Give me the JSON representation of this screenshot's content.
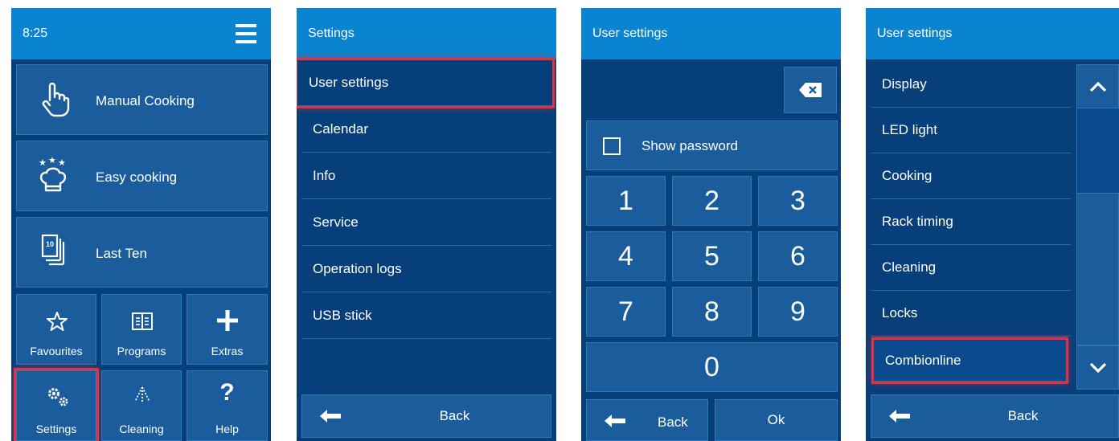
{
  "screen1": {
    "time": "8:25",
    "tiles": {
      "manual_cooking": "Manual Cooking",
      "easy_cooking": "Easy cooking",
      "last_ten": "Last Ten",
      "last_ten_badge": "10",
      "favourites": "Favourites",
      "programs": "Programs",
      "extras": "Extras",
      "settings": "Settings",
      "cleaning": "Cleaning",
      "help": "Help"
    }
  },
  "screen2": {
    "title": "Settings",
    "items": [
      "User settings",
      "Calendar",
      "Info",
      "Service",
      "Operation logs",
      "USB stick"
    ],
    "back_label": "Back"
  },
  "screen3": {
    "title": "User settings",
    "show_password_label": "Show password",
    "keys": [
      "1",
      "2",
      "3",
      "4",
      "5",
      "6",
      "7",
      "8",
      "9",
      "0"
    ],
    "back_label": "Back",
    "ok_label": "Ok"
  },
  "screen4": {
    "title": "User settings",
    "items": [
      "Display",
      "LED light",
      "Cooking",
      "Rack timing",
      "Cleaning",
      "Locks",
      "Combionline"
    ],
    "back_label": "Back"
  },
  "colors": {
    "header": "#0a84d0",
    "background": "#063f7a",
    "tile": "#1a5c9c",
    "highlight": "#e0323f"
  }
}
